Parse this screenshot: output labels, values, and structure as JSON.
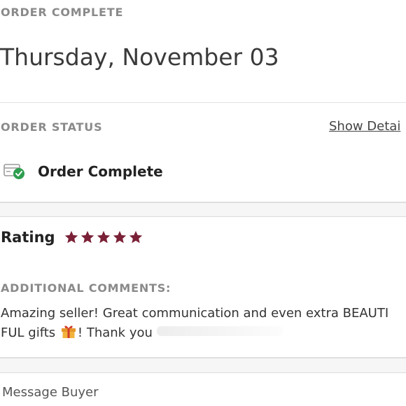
{
  "header": {
    "section_label": "ORDER COMPLETE",
    "date": "Thursday, November 03"
  },
  "order_status": {
    "section_label": "ORDER STATUS",
    "show_details_label": "Show Detai",
    "status_text": "Order Complete",
    "status_icon": "package-check-icon",
    "status_icon_check_color": "#2e9e4f"
  },
  "rating": {
    "label": "Rating",
    "stars_filled": 5,
    "stars_total": 5,
    "star_color": "#7b2137"
  },
  "comments": {
    "section_label": "ADDITIONAL COMMENTS:",
    "line1": "Amazing seller! Great communication and even extra BEAUTI",
    "line2_before_icon": "FUL gifts ",
    "line2_after_icon": "! Thank you ",
    "gift_icon": "gift-icon"
  },
  "actions": {
    "message_buyer_label": "Message Buyer"
  }
}
